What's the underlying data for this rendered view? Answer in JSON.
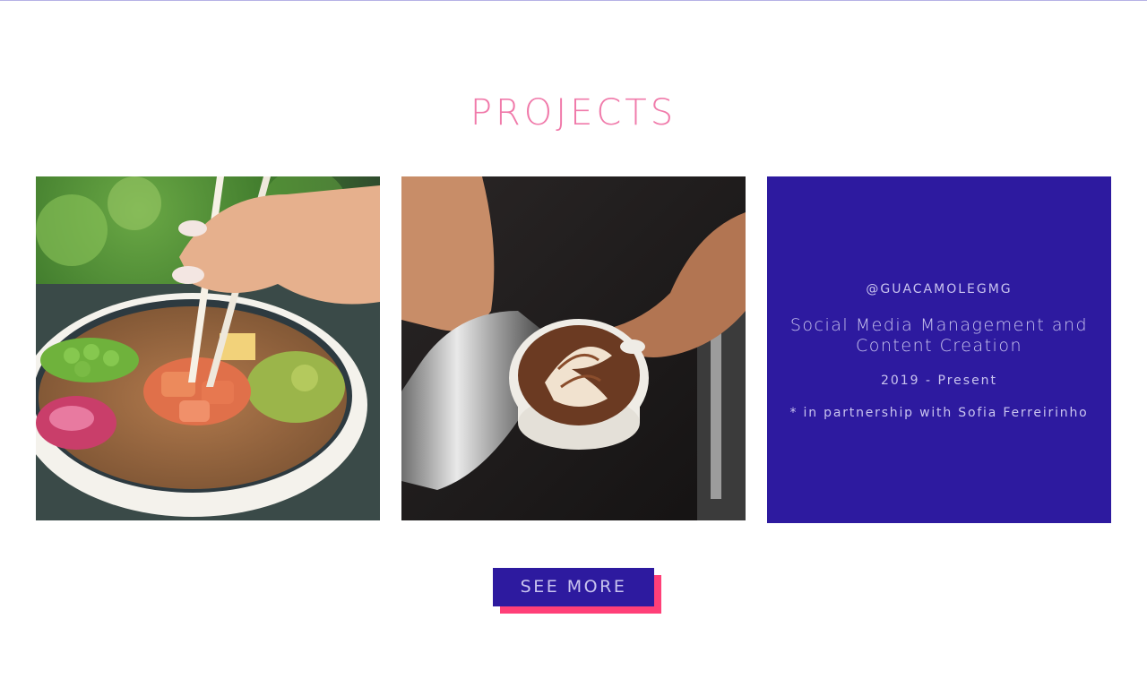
{
  "section": {
    "title": "PROJECTS"
  },
  "projects": [
    {
      "image": "poke-bowl-with-chopsticks-photo",
      "alt": "Poke bowl with salmon, edamame and chopsticks"
    },
    {
      "image": "latte-art-pour-photo",
      "alt": "Barista pouring latte art into a cup"
    },
    {
      "handle": "@GUACAMOLEGMG",
      "title": "Social Media Management and Content Creation",
      "years": "2019 - Present",
      "partner": "* in partnership with Sofia Ferreirinho"
    }
  ],
  "cta": {
    "label": "SEE MORE"
  },
  "colors": {
    "accent_pink": "#f07aaa",
    "button_shadow": "#ff3f78",
    "brand_purple": "#2d1a9f",
    "muted_text": "#c9c4ef"
  }
}
